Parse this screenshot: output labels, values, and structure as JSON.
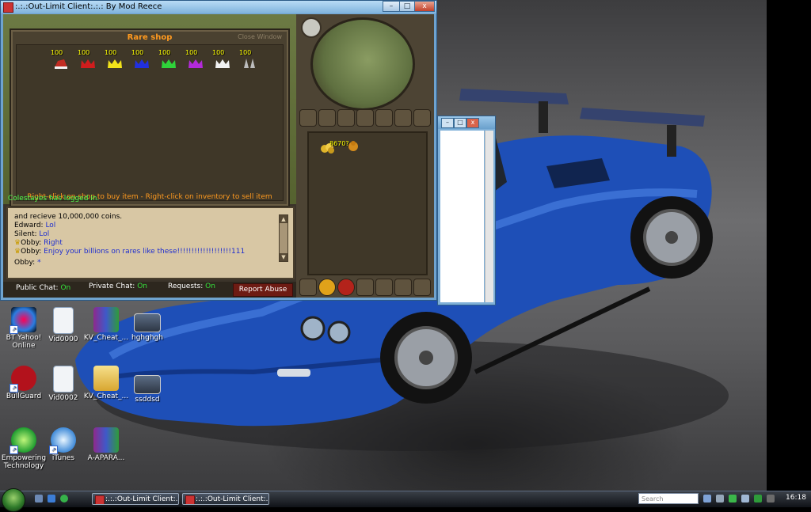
{
  "window": {
    "title": ":.:.:Out-Limit Client:.:.: By Mod Reece",
    "minimize": "–",
    "maximize": "□",
    "close": "x"
  },
  "shop": {
    "title": "Rare shop",
    "close_label": "Close Window",
    "help_text": "Right-click on shop to buy item - Right-click on inventory to sell item",
    "items": [
      {
        "qty": "100",
        "icon": "santa-hat-icon",
        "color": "#c22c22"
      },
      {
        "qty": "100",
        "icon": "red-partyhat-icon",
        "color": "#d11d1d"
      },
      {
        "qty": "100",
        "icon": "yellow-partyhat-icon",
        "color": "#f2e21a"
      },
      {
        "qty": "100",
        "icon": "blue-partyhat-icon",
        "color": "#2130e0"
      },
      {
        "qty": "100",
        "icon": "green-partyhat-icon",
        "color": "#2fd33a"
      },
      {
        "qty": "100",
        "icon": "purple-partyhat-icon",
        "color": "#b32ad9"
      },
      {
        "qty": "100",
        "icon": "white-partyhat-icon",
        "color": "#f2f2f2"
      },
      {
        "qty": "100",
        "icon": "bunny-ears-icon",
        "color": "#bcbcbc"
      }
    ]
  },
  "chat": {
    "top_note": "Colestayes has logged in.",
    "lines": [
      {
        "name": "",
        "text": "and recieve 10,000,000 coins."
      },
      {
        "name": "Edward:",
        "text": "Lol"
      },
      {
        "name": "Silent:",
        "text": "Lol"
      },
      {
        "name": "Obby:",
        "text": "Right"
      },
      {
        "name": "Obby:",
        "text": "Enjoy your billions on rares like these!!!!!!!!!!!!!!!!!!!111"
      },
      {
        "name": "Obby:",
        "text": "*"
      }
    ]
  },
  "chat_buttons": {
    "public": "Public Chat:",
    "public_state": "On",
    "private": "Private Chat:",
    "private_state": "On",
    "requests": "Requests:",
    "requests_state": "On",
    "report": "Report Abuse"
  },
  "inventory": {
    "coins_qty": "8670?"
  },
  "desktop_icons": [
    {
      "label": "BT Yahoo! Online",
      "icon": "bt-yahoo-icon"
    },
    {
      "label": "BullGuard",
      "icon": "bullguard-icon"
    },
    {
      "label": "Empowering Technology",
      "icon": "empowering-technology-icon"
    },
    {
      "label": "Vid0000",
      "icon": "3gpp-file-icon"
    },
    {
      "label": "Vid0002",
      "icon": "3gpp-file-icon"
    },
    {
      "label": "iTunes",
      "icon": "itunes-icon"
    },
    {
      "label": "KV_Cheat_...",
      "icon": "winrar-archive-icon"
    },
    {
      "label": "KV_Cheat_...",
      "icon": "folder-icon"
    },
    {
      "label": "A-APARA...",
      "icon": "winrar-archive-icon"
    },
    {
      "label": "hghghgh",
      "icon": "image-file-icon"
    },
    {
      "label": "ssddsd",
      "icon": "image-file-icon"
    }
  ],
  "taskbar": {
    "tasks": [
      ":.:.:Out-Limit Client:...",
      ":.:.:Out-Limit Client:..."
    ],
    "search_placeholder": "Search",
    "clock": "16:18"
  }
}
